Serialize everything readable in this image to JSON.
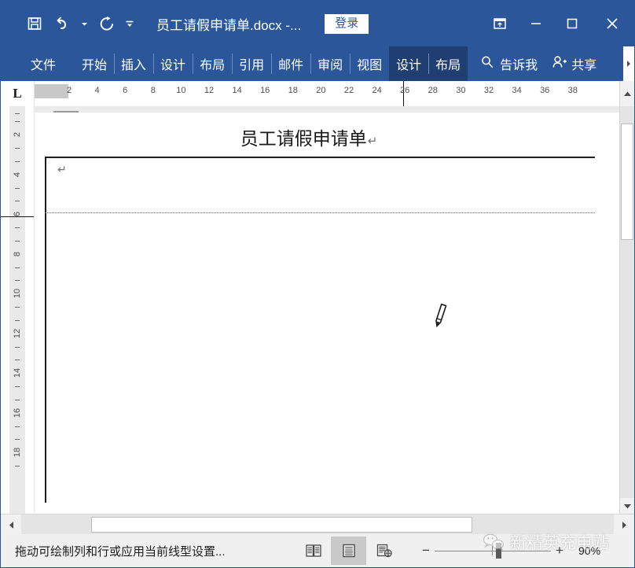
{
  "window": {
    "title": "员工请假申请单.docx -...",
    "signin_label": "登录",
    "accent_color": "#2b579a",
    "contextual_tab_color": "#1f3f72"
  },
  "quick_access": [
    {
      "name": "save-icon",
      "label": "保存"
    },
    {
      "name": "undo-icon",
      "label": "撤消"
    },
    {
      "name": "redo-icon",
      "label": "恢复"
    },
    {
      "name": "customize-qat-icon",
      "label": "自定义快速访问工具栏"
    }
  ],
  "window_controls": [
    {
      "name": "ribbon-display-options-icon",
      "label": "功能区显示选项"
    },
    {
      "name": "minimize-icon",
      "label": "最小化"
    },
    {
      "name": "maximize-icon",
      "label": "最大化"
    },
    {
      "name": "close-icon",
      "label": "关闭"
    }
  ],
  "ribbon": {
    "file_tab": "文件",
    "tabs": [
      {
        "label": "开始",
        "active": false
      },
      {
        "label": "插入",
        "active": false
      },
      {
        "label": "设计",
        "active": false
      },
      {
        "label": "布局",
        "active": false
      },
      {
        "label": "引用",
        "active": false
      },
      {
        "label": "邮件",
        "active": false
      },
      {
        "label": "审阅",
        "active": false
      },
      {
        "label": "视图",
        "active": false
      },
      {
        "label": "设计",
        "active": true
      },
      {
        "label": "布局",
        "active": true
      }
    ],
    "tell_me": "告诉我",
    "share": "共享"
  },
  "ruler": {
    "tab_selector": "L",
    "horizontal_ticks": [
      2,
      4,
      6,
      8,
      10,
      12,
      14,
      16,
      18,
      20,
      22,
      24,
      26,
      28,
      30,
      32,
      34,
      36,
      38
    ],
    "vertical_ticks": [
      2,
      4,
      6,
      8,
      10,
      12,
      14,
      16,
      18
    ]
  },
  "document": {
    "heading": "员工请假申请单",
    "paragraph_mark": "↵",
    "cell_paragraph_mark": "↵",
    "cursor": "pencil-draw-table-cursor"
  },
  "statusbar": {
    "message": "拖动可绘制列和行或应用当前线型设置...",
    "views": [
      {
        "name": "read-mode-view-button",
        "label": "阅读视图",
        "active": false
      },
      {
        "name": "print-layout-view-button",
        "label": "页面视图",
        "active": true
      },
      {
        "name": "web-layout-view-button",
        "label": "Web 版式视图",
        "active": false
      }
    ],
    "zoom_out_label": "−",
    "zoom_in_label": "+",
    "zoom_level": "90%"
  },
  "watermark": {
    "text": "新精英充电站",
    "icon": "wechat-icon"
  }
}
